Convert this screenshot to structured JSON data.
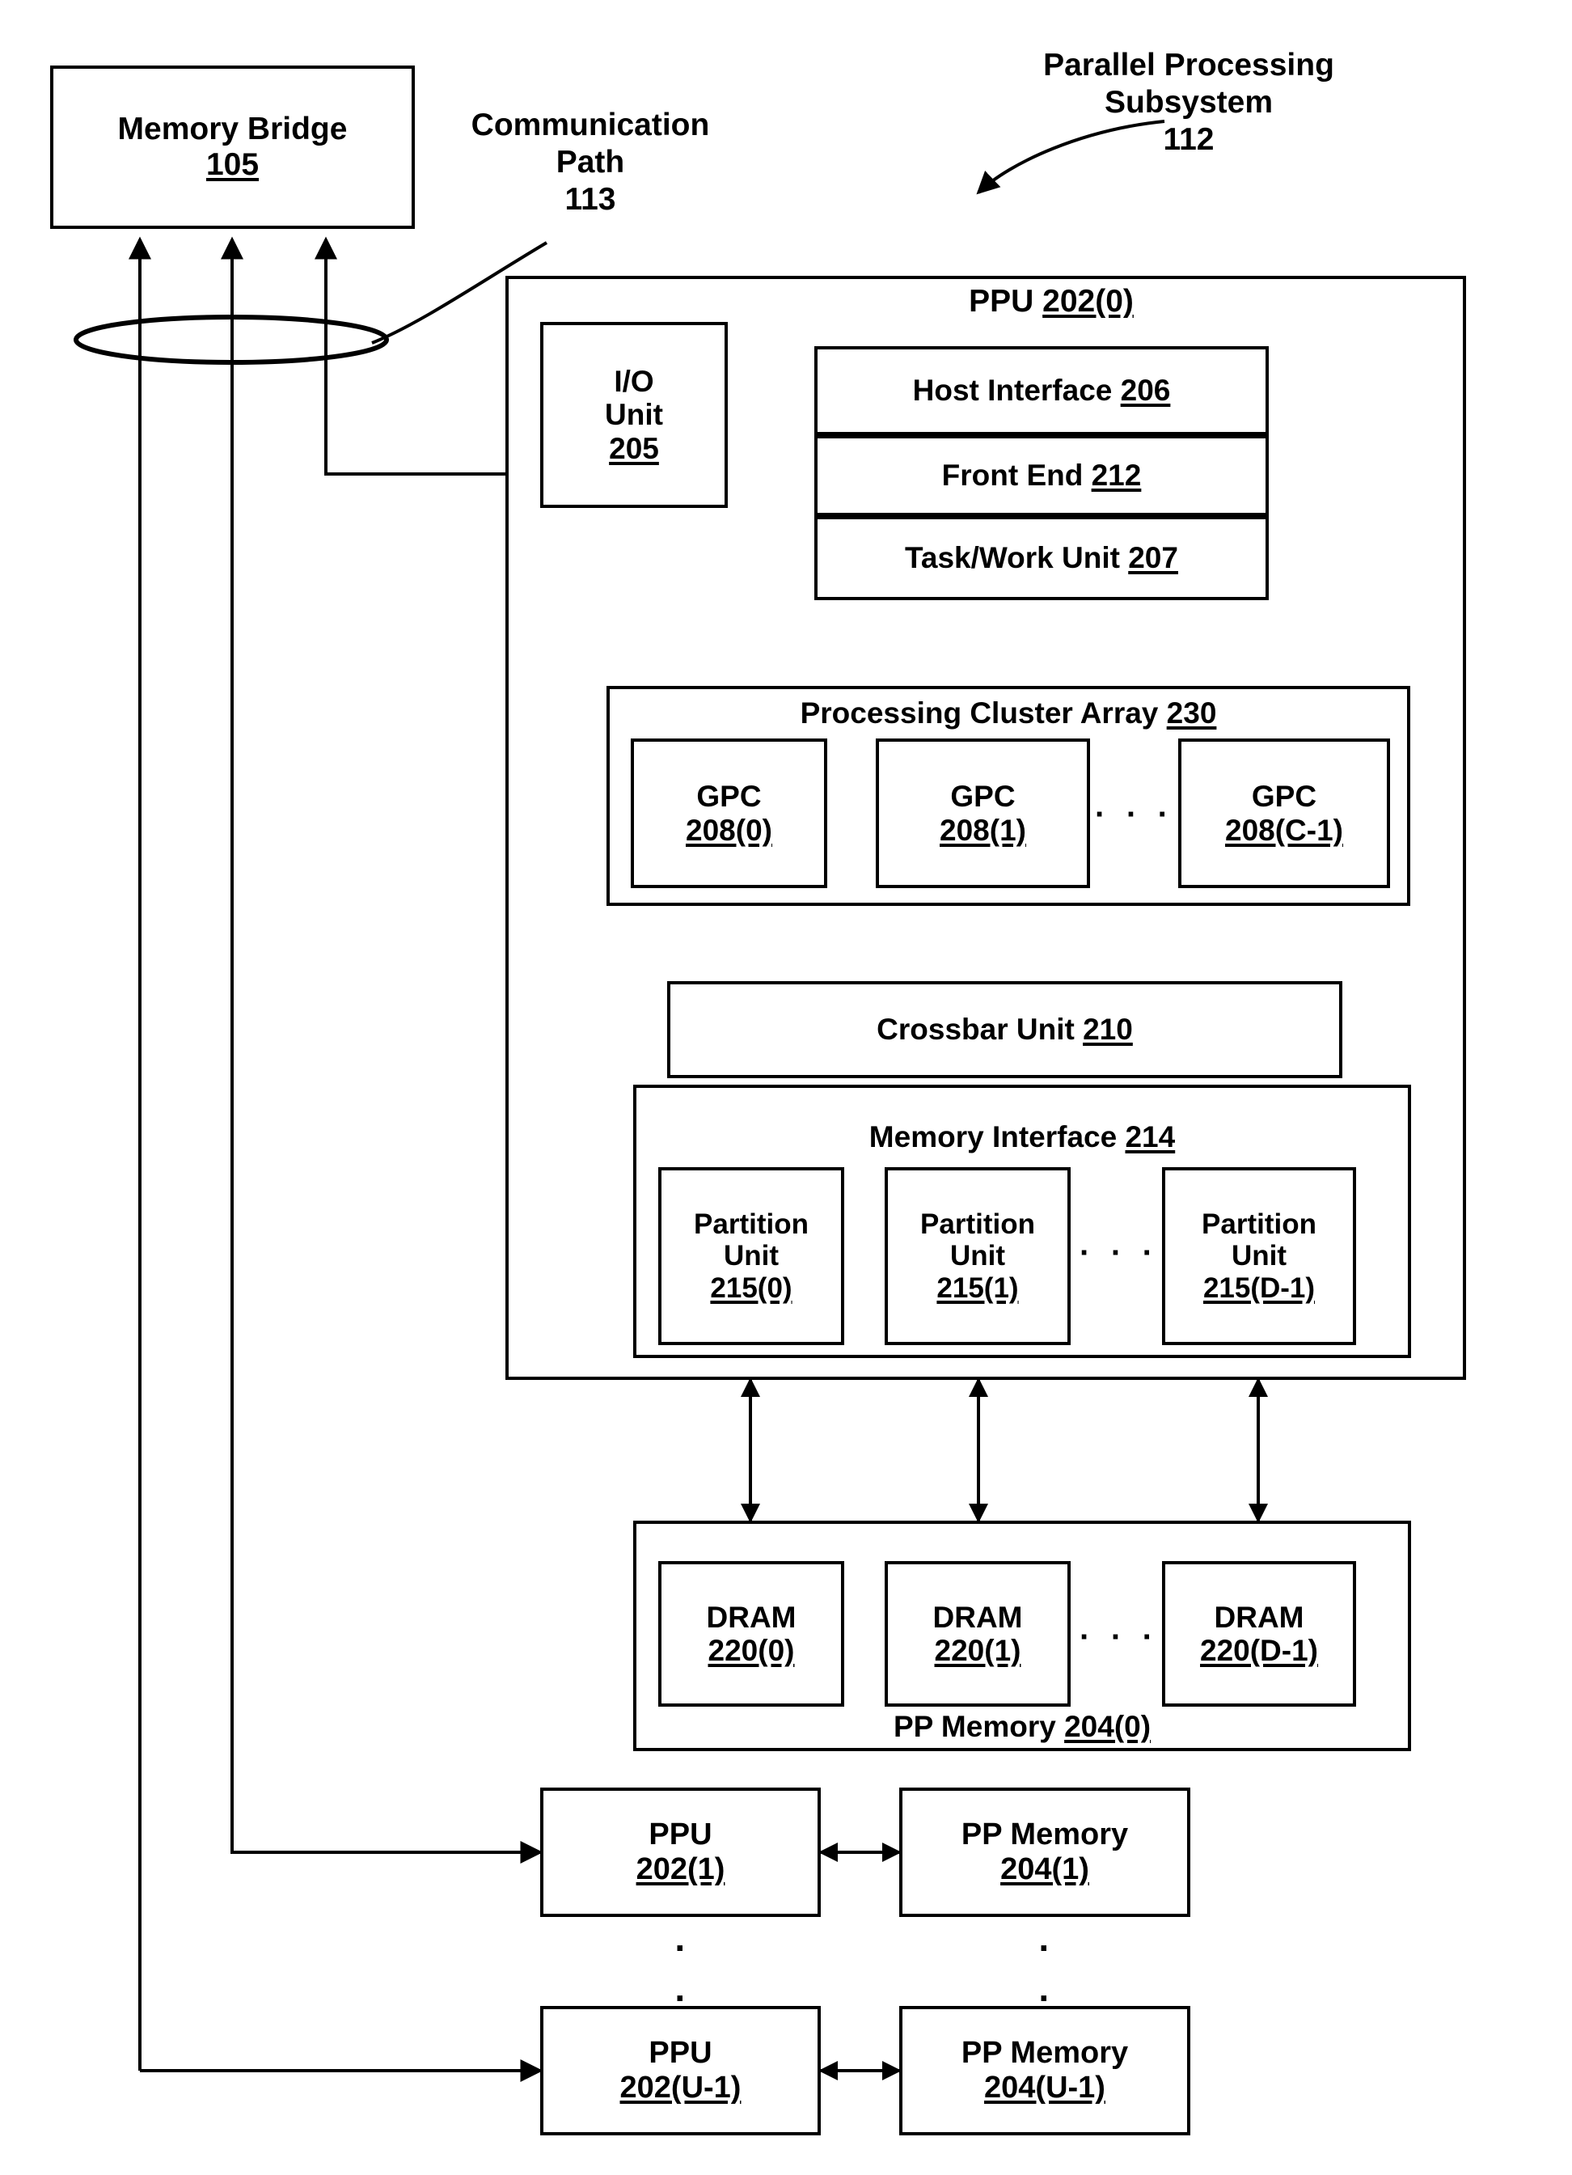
{
  "figure": {
    "memory_bridge": {
      "name": "Memory Bridge",
      "ref": "105"
    },
    "communication_path": {
      "line1": "Communication",
      "line2": "Path",
      "ref": "113"
    },
    "subsystem": {
      "line1": "Parallel Processing",
      "line2": "Subsystem",
      "ref": "112"
    },
    "ppu0": {
      "title_name": "PPU",
      "title_ref": "202(0)",
      "io_unit": {
        "line1": "I/O",
        "line2": "Unit",
        "ref": "205"
      },
      "host_interface": {
        "name": "Host Interface",
        "ref": "206"
      },
      "front_end": {
        "name": "Front End",
        "ref": "212"
      },
      "task_work_unit": {
        "name": "Task/Work Unit",
        "ref": "207"
      },
      "cluster_array": {
        "name": "Processing Cluster Array",
        "ref": "230",
        "ellipsis": "· · ·",
        "gpcs": [
          {
            "name": "GPC",
            "ref": "208(0)"
          },
          {
            "name": "GPC",
            "ref": "208(1)"
          },
          {
            "name": "GPC",
            "ref": "208(C-1)"
          }
        ]
      },
      "crossbar_unit": {
        "name": "Crossbar Unit",
        "ref": "210"
      },
      "memory_interface": {
        "name": "Memory Interface",
        "ref": "214",
        "ellipsis": "· · ·",
        "partitions": [
          {
            "line1": "Partition",
            "line2": "Unit",
            "ref": "215(0)"
          },
          {
            "line1": "Partition",
            "line2": "Unit",
            "ref": "215(1)"
          },
          {
            "line1": "Partition",
            "line2": "Unit",
            "ref": "215(D-1)"
          }
        ]
      }
    },
    "pp_memory0": {
      "name": "PP Memory",
      "ref": "204(0)",
      "ellipsis": "· · ·",
      "drams": [
        {
          "name": "DRAM",
          "ref": "220(0)"
        },
        {
          "name": "DRAM",
          "ref": "220(1)"
        },
        {
          "name": "DRAM",
          "ref": "220(D-1)"
        }
      ]
    },
    "additional_units": [
      {
        "ppu": {
          "name": "PPU",
          "ref": "202(1)"
        },
        "memory": {
          "name": "PP Memory",
          "ref": "204(1)"
        }
      },
      {
        "ppu": {
          "name": "PPU",
          "ref": "202(U-1)"
        },
        "memory": {
          "name": "PP Memory",
          "ref": "204(U-1)"
        }
      }
    ],
    "vertical_ellipsis": "·"
  },
  "colors": {
    "ink": "#000000",
    "paper": "#ffffff"
  }
}
